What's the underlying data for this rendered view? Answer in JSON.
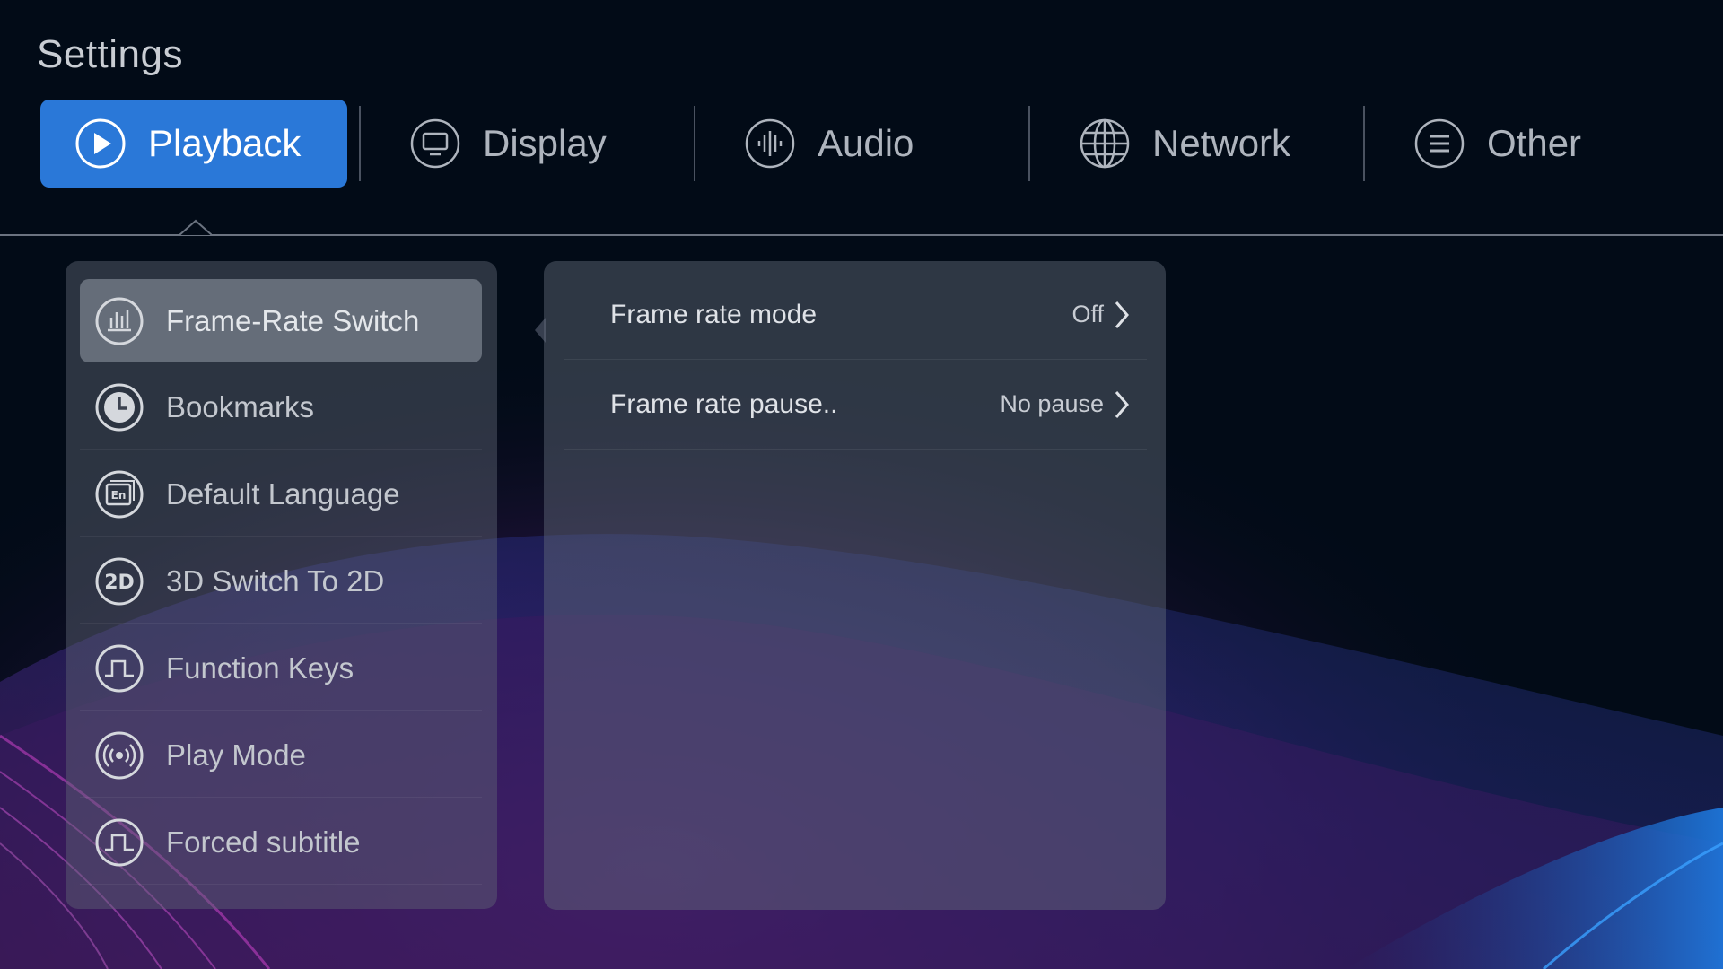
{
  "page": {
    "title": "Settings"
  },
  "tabs": [
    {
      "label": "Playback",
      "icon": "play-circle-icon",
      "active": true
    },
    {
      "label": "Display",
      "icon": "monitor-icon",
      "active": false
    },
    {
      "label": "Audio",
      "icon": "audio-wave-icon",
      "active": false
    },
    {
      "label": "Network",
      "icon": "globe-icon",
      "active": false
    },
    {
      "label": "Other",
      "icon": "menu-lines-icon",
      "active": false
    }
  ],
  "menu": {
    "items": [
      {
        "label": "Frame-Rate Switch",
        "icon": "bar-chart-icon",
        "selected": true
      },
      {
        "label": "Bookmarks",
        "icon": "clock-icon",
        "selected": false
      },
      {
        "label": "Default Language",
        "icon": "language-en-icon",
        "selected": false
      },
      {
        "label": "3D Switch To 2D",
        "icon": "2d-icon",
        "selected": false
      },
      {
        "label": "Function Keys",
        "icon": "pulse-wave-icon",
        "selected": false
      },
      {
        "label": "Play Mode",
        "icon": "broadcast-icon",
        "selected": false
      },
      {
        "label": "Forced subtitle",
        "icon": "pulse-wave-icon",
        "selected": false
      }
    ]
  },
  "options": [
    {
      "label": "Frame rate mode",
      "value": "Off"
    },
    {
      "label": "Frame rate pause..",
      "value": "No pause"
    }
  ],
  "colors": {
    "background": "#020b17",
    "accent": "#2a78d8",
    "text_primary": "#dfe2e7",
    "text_secondary": "#aeb4bd",
    "wave_magenta": "#7a2a7a",
    "wave_blue": "#1b6fd6"
  }
}
